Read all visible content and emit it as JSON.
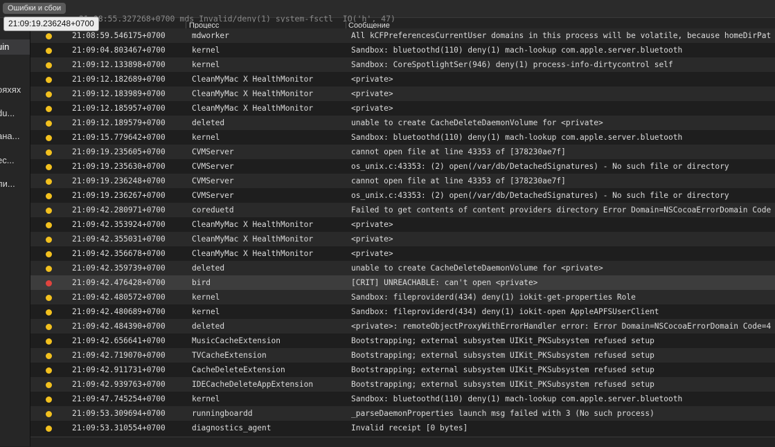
{
  "toolbar": {
    "filter_label": "Ошибки и сбои"
  },
  "tooltip": {
    "text": "21:09:19.236248+0700"
  },
  "sidebar": {
    "items": [
      {
        "label": "uin"
      },
      {
        "label": "ояхях"
      },
      {
        "label": "du..."
      },
      {
        "label": "ана..."
      },
      {
        "label": "ес..."
      },
      {
        "label": "ли..."
      }
    ]
  },
  "columns": {
    "process": "Процесс",
    "message": "Сообщение"
  },
  "partial_row": {
    "top_text": "21:08:55.327268+0700   mds                          Invalid/deny(1) system-fsctl _IO('h', 47)",
    "time": "21:08:59.546175+0700",
    "process": "mdworker",
    "message": "All kCFPreferencesCurrentUser domains in this process will be volatile, because homeDirPat"
  },
  "rows": [
    {
      "time": "21:09:04.803467+0700",
      "process": "kernel",
      "message": "Sandbox: bluetoothd(110) deny(1) mach-lookup com.apple.server.bluetooth",
      "level": "error"
    },
    {
      "time": "21:09:12.133898+0700",
      "process": "kernel",
      "message": "Sandbox: CoreSpotlightSer(946) deny(1) process-info-dirtycontrol self",
      "level": "error"
    },
    {
      "time": "21:09:12.182689+0700",
      "process": "CleanMyMac X HealthMonitor",
      "message": "<private>",
      "level": "error"
    },
    {
      "time": "21:09:12.183989+0700",
      "process": "CleanMyMac X HealthMonitor",
      "message": "<private>",
      "level": "error"
    },
    {
      "time": "21:09:12.185957+0700",
      "process": "CleanMyMac X HealthMonitor",
      "message": "<private>",
      "level": "error"
    },
    {
      "time": "21:09:12.189579+0700",
      "process": "deleted",
      "message": "unable to create CacheDeleteDaemonVolume for <private>",
      "level": "error"
    },
    {
      "time": "21:09:15.779642+0700",
      "process": "kernel",
      "message": "Sandbox: bluetoothd(110) deny(1) mach-lookup com.apple.server.bluetooth",
      "level": "error"
    },
    {
      "time": "21:09:19.235605+0700",
      "process": "CVMServer",
      "message": "cannot open file at line 43353 of [378230ae7f]",
      "level": "error"
    },
    {
      "time": "21:09:19.235630+0700",
      "process": "CVMServer",
      "message": "os_unix.c:43353: (2) open(/var/db/DetachedSignatures) - No such file or directory",
      "level": "error"
    },
    {
      "time": "21:09:19.236248+0700",
      "process": "CVMServer",
      "message": "cannot open file at line 43353 of [378230ae7f]",
      "level": "error"
    },
    {
      "time": "21:09:19.236267+0700",
      "process": "CVMServer",
      "message": "os_unix.c:43353: (2) open(/var/db/DetachedSignatures) - No such file or directory",
      "level": "error"
    },
    {
      "time": "21:09:42.280971+0700",
      "process": "coreduetd",
      "message": "Failed to get contents of content providers directory Error Domain=NSCocoaErrorDomain Code",
      "level": "error"
    },
    {
      "time": "21:09:42.353924+0700",
      "process": "CleanMyMac X HealthMonitor",
      "message": "<private>",
      "level": "error"
    },
    {
      "time": "21:09:42.355031+0700",
      "process": "CleanMyMac X HealthMonitor",
      "message": "<private>",
      "level": "error"
    },
    {
      "time": "21:09:42.356678+0700",
      "process": "CleanMyMac X HealthMonitor",
      "message": "<private>",
      "level": "error"
    },
    {
      "time": "21:09:42.359739+0700",
      "process": "deleted",
      "message": "unable to create CacheDeleteDaemonVolume for <private>",
      "level": "error"
    },
    {
      "time": "21:09:42.476428+0700",
      "process": "bird",
      "message": "[CRIT] UNREACHABLE: can't open <private>",
      "level": "fault"
    },
    {
      "time": "21:09:42.480572+0700",
      "process": "kernel",
      "message": "Sandbox: fileproviderd(434) deny(1) iokit-get-properties Role",
      "level": "error"
    },
    {
      "time": "21:09:42.480689+0700",
      "process": "kernel",
      "message": "Sandbox: fileproviderd(434) deny(1) iokit-open AppleAPFSUserClient",
      "level": "error"
    },
    {
      "time": "21:09:42.484390+0700",
      "process": "deleted",
      "message": "<private>: remoteObjectProxyWithErrorHandler error: Error Domain=NSCocoaErrorDomain Code=4",
      "level": "error"
    },
    {
      "time": "21:09:42.656641+0700",
      "process": "MusicCacheExtension",
      "message": "Bootstrapping; external subsystem UIKit_PKSubsystem refused setup",
      "level": "error"
    },
    {
      "time": "21:09:42.719070+0700",
      "process": "TVCacheExtension",
      "message": "Bootstrapping; external subsystem UIKit_PKSubsystem refused setup",
      "level": "error"
    },
    {
      "time": "21:09:42.911731+0700",
      "process": "CacheDeleteExtension",
      "message": "Bootstrapping; external subsystem UIKit_PKSubsystem refused setup",
      "level": "error"
    },
    {
      "time": "21:09:42.939763+0700",
      "process": "IDECacheDeleteAppExtension",
      "message": "Bootstrapping; external subsystem UIKit_PKSubsystem refused setup",
      "level": "error"
    },
    {
      "time": "21:09:47.745254+0700",
      "process": "kernel",
      "message": "Sandbox: bluetoothd(110) deny(1) mach-lookup com.apple.server.bluetooth",
      "level": "error"
    },
    {
      "time": "21:09:53.309694+0700",
      "process": "runningboardd",
      "message": "_parseDaemonProperties launch msg failed with 3 (No such process)",
      "level": "error"
    },
    {
      "time": "21:09:53.310554+0700",
      "process": "diagnostics_agent",
      "message": "Invalid receipt [0 bytes]",
      "level": "error"
    }
  ],
  "colors": {
    "error": "#f2c01e",
    "fault": "#e0443e"
  }
}
